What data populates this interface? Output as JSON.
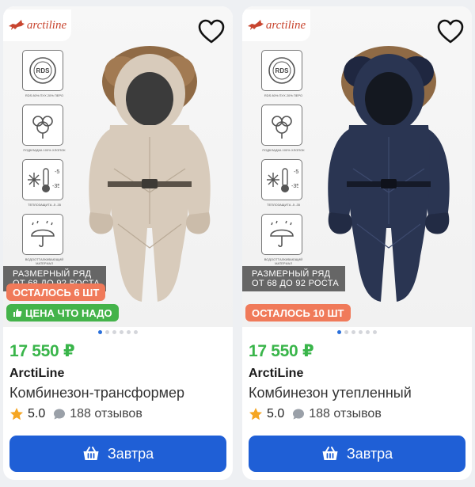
{
  "icons": {
    "favorite": "heart-icon",
    "rating": "star-icon",
    "reviews": "comment-bubble-icon",
    "cart": "basket-icon",
    "promo": "thumbs-up-icon"
  },
  "colors": {
    "price": "#39b54a",
    "cta": "#1f5fd6",
    "stock_badge": "#f07a5a",
    "promo_badge": "#44b34a",
    "carousel_active": "#2a6fdb"
  },
  "products": [
    {
      "logo_text": "arctiline",
      "spec_badges": [
        "RDS 80% ПУХ 20% ПЕРО",
        "ПОДКЛАДКА 100% ХЛОПОК",
        "ТЕПЛОЗАЩИТА -5 -35",
        "ВОДООТТАЛКИВАЮЩИЙ МАТЕРИАЛ"
      ],
      "size_range_line1": "РАЗМЕРНЫЙ РЯД",
      "size_range_line2": "ОТ 68 ДО 92 РОСТА",
      "stock_badge": "ОСТАЛОСЬ 6 ШТ",
      "promo_badge": "ЦЕНА ЧТО НАДО",
      "suit_color": "#d8cbbb",
      "carousel": {
        "count": 6,
        "active": 1
      },
      "price": "17 550 ₽",
      "brand": "ArctiLine",
      "title": "Комбинезон-трансформер",
      "rating": "5.0",
      "reviews": "188 отзывов",
      "cta_label": "Завтра"
    },
    {
      "logo_text": "arctiline",
      "spec_badges": [
        "RDS 80% ПУХ 20% ПЕРО",
        "ПОДКЛАДКА 100% ХЛОПОК",
        "ТЕПЛОЗАЩИТА -5 -35",
        "ВОДООТТАЛКИВАЮЩИЙ МАТЕРИАЛ"
      ],
      "size_range_line1": "РАЗМЕРНЫЙ РЯД",
      "size_range_line2": "ОТ 68 ДО 92 РОСТА",
      "stock_badge": "ОСТАЛОСЬ 10 ШТ",
      "suit_color": "#2a3552",
      "carousel": {
        "count": 6,
        "active": 1
      },
      "price": "17 550 ₽",
      "brand": "ArctiLine",
      "title": "Комбинезон утепленный",
      "rating": "5.0",
      "reviews": "188 отзывов",
      "cta_label": "Завтра"
    }
  ]
}
